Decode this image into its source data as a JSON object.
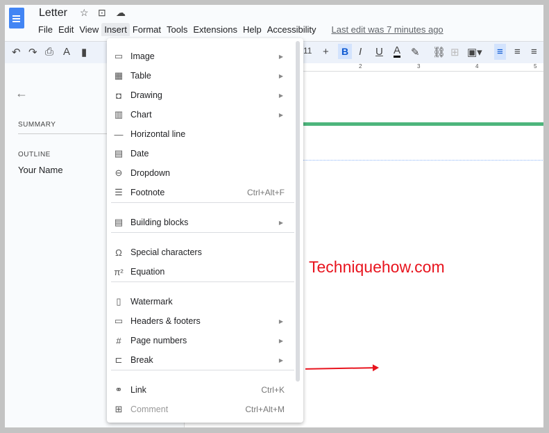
{
  "app": {
    "title": "Letter",
    "icons": [
      "star-icon",
      "move-folder-icon",
      "cloud-saved-icon"
    ]
  },
  "menubar": {
    "items": [
      "File",
      "Edit",
      "View",
      "Insert",
      "Format",
      "Tools",
      "Extensions",
      "Help",
      "Accessibility"
    ],
    "last_edit": "Last edit was 7 minutes ago",
    "active": "Insert"
  },
  "toolbar": {
    "font_size": "11",
    "plus": "+",
    "bold": "B",
    "italic": "I",
    "underline": "U",
    "text_color": "A"
  },
  "ruler": [
    "2",
    "3",
    "4",
    "5"
  ],
  "sidebar": {
    "summary": "SUMMARY",
    "outline": "OUTLINE",
    "item": "Your Name"
  },
  "document": {
    "watermark_text": "Techniquehow.com",
    "accent": "#4db57c",
    "annotation_color": "#e8141e"
  },
  "menu": {
    "items": [
      {
        "icon": "image-icon",
        "label": "Image",
        "sub": true
      },
      {
        "icon": "table-icon",
        "label": "Table",
        "sub": true
      },
      {
        "icon": "drawing-icon",
        "label": "Drawing",
        "sub": true
      },
      {
        "icon": "chart-icon",
        "label": "Chart",
        "sub": true
      },
      {
        "icon": "horizontal-line-icon",
        "label": "Horizontal line"
      },
      {
        "icon": "date-icon",
        "label": "Date"
      },
      {
        "icon": "dropdown-icon",
        "label": "Dropdown"
      },
      {
        "icon": "footnote-icon",
        "label": "Footnote",
        "shortcut": "Ctrl+Alt+F"
      },
      {
        "icon": "building-blocks-icon",
        "label": "Building blocks",
        "sub": true
      },
      {
        "icon": "omega-icon",
        "label": "Special characters"
      },
      {
        "icon": "equation-icon",
        "label": "Equation"
      },
      {
        "icon": "watermark-icon",
        "label": "Watermark"
      },
      {
        "icon": "headers-footers-icon",
        "label": "Headers & footers",
        "sub": true
      },
      {
        "icon": "hash-icon",
        "label": "Page numbers",
        "sub": true
      },
      {
        "icon": "break-icon",
        "label": "Break",
        "sub": true
      },
      {
        "icon": "link-icon",
        "label": "Link",
        "shortcut": "Ctrl+K"
      },
      {
        "icon": "comment-icon",
        "label": "Comment",
        "shortcut": "Ctrl+Alt+M",
        "disabled": true
      }
    ]
  }
}
